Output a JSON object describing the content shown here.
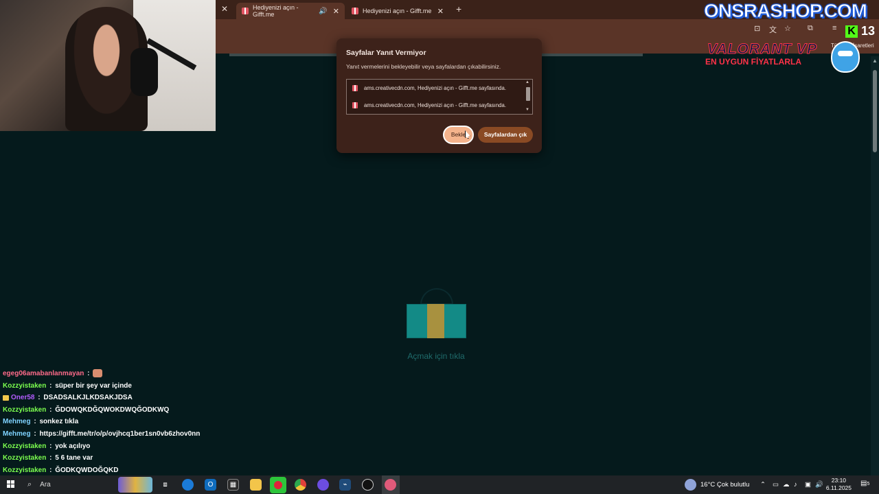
{
  "browser": {
    "tabs": [
      {
        "label": "Hediyenizi açın - Gifft.me",
        "active": true,
        "muted_icon": "speaker-icon"
      },
      {
        "label": "Hediyenizi açın - Gifft.me",
        "active": false
      }
    ],
    "bookmark_text": "Tüm Yer İşaretleri"
  },
  "dialog": {
    "title": "Sayfalar Yanıt Vermiyor",
    "subtitle": "Yanıt vermelerini bekleyebilir veya sayfalardan çıkabilirsiniz.",
    "pages": [
      "ams.creativecdn.com, Hediyenizi açın - Gifft.me sayfasında.",
      "ams.creativecdn.com, Hediyenizi açın - Gifft.me sayfasında."
    ],
    "wait_label": "Bekle",
    "exit_label": "Sayfalardan çık"
  },
  "page": {
    "gift_text": "Açmak için tıkla"
  },
  "overlay": {
    "brand": "ONSRASHOP.COM",
    "kick_count": "13",
    "valorant_title": "VALORANT VP",
    "valorant_sub": "EN UYGUN FİYATLARLA"
  },
  "chat": [
    {
      "user": "egeg06amabanlanmayan",
      "color": "#ff6b8a",
      "text": "",
      "emote": true,
      "badge": false
    },
    {
      "user": "Kozzyistaken",
      "color": "#7cff4f",
      "text": "süper bir şey var içinde",
      "badge": false
    },
    {
      "user": "Oner58",
      "color": "#b35cff",
      "text": "DSADSALKJLKDSAKJDSA",
      "badge": true
    },
    {
      "user": "Kozzyistaken",
      "color": "#7cff4f",
      "text": "ĞDOWQKDĞQWOKDWQĞODKWQ",
      "badge": false
    },
    {
      "user": "Mehmeg",
      "color": "#7fd3ff",
      "text": "sonkez tıkla",
      "badge": false
    },
    {
      "user": "Mehmeg",
      "color": "#7fd3ff",
      "text": "https://gifft.me/tr/o/p/ovjhcq1ber1sn0vb6zhov0nn",
      "badge": false
    },
    {
      "user": "Kozzyistaken",
      "color": "#7cff4f",
      "text": "yok açılıyo",
      "badge": false
    },
    {
      "user": "Kozzyistaken",
      "color": "#7cff4f",
      "text": "5 6 tane var",
      "badge": false
    },
    {
      "user": "Kozzyistaken",
      "color": "#7cff4f",
      "text": "ĞODKQWDOĞQKD",
      "badge": false
    }
  ],
  "taskbar": {
    "search_placeholder": "Ara",
    "weather": "16°C  Çok bulutlu",
    "time": "23:10",
    "date": "6.11.2025",
    "notification_count": "5"
  },
  "colors": {
    "page_bg": "#051a1c",
    "browser_frame": "#5a3427",
    "accent_button": "#f4b38c"
  }
}
